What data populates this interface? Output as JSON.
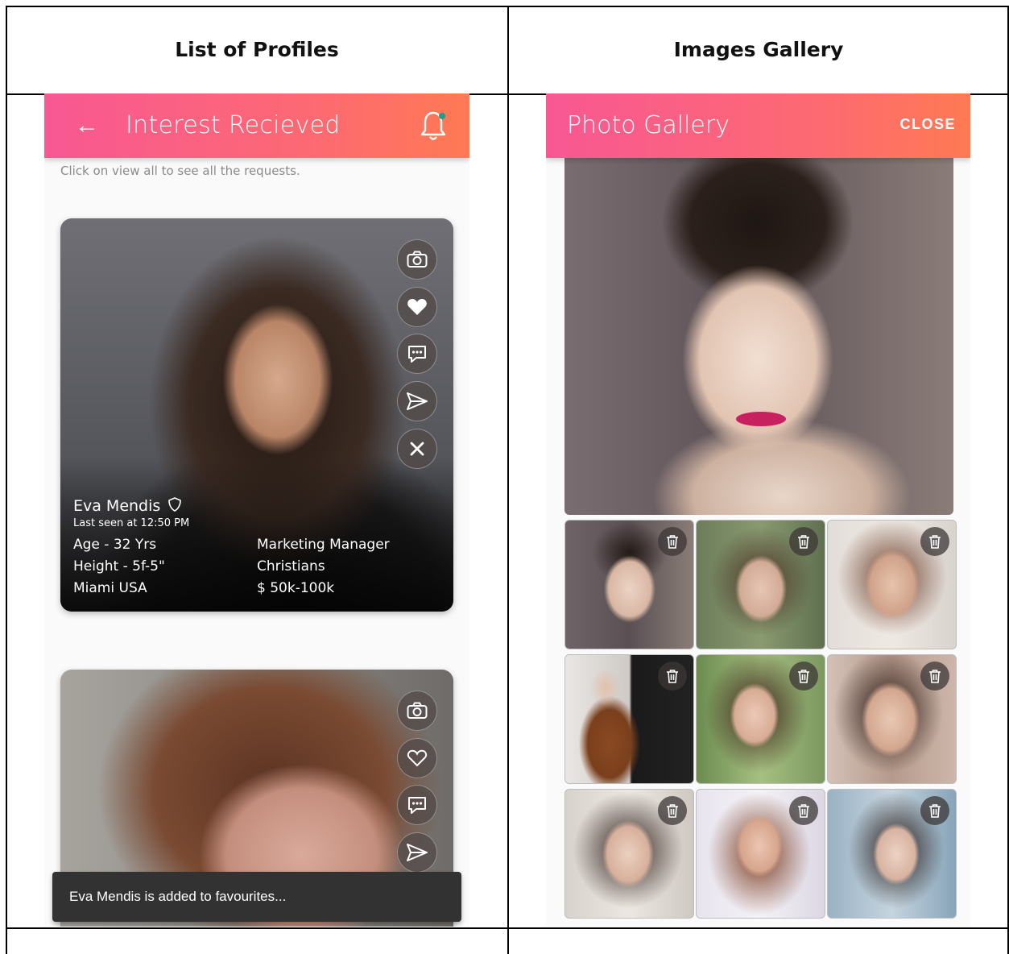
{
  "columns": [
    {
      "heading": "List of  Profiles"
    },
    {
      "heading": "Images Gallery"
    }
  ],
  "left_screen": {
    "appbar": {
      "back_icon": "arrow-left-icon",
      "title": "Interest Recieved",
      "notification_icon": "bell-icon",
      "notification_dot_color": "#1e9e86"
    },
    "hint": "Click on view all to see all the requests.",
    "profile": {
      "name": "Eva Mendis",
      "badge_icon": "shield-icon",
      "last_seen": "Last seen at 12:50 PM",
      "age": "Age - 32 Yrs",
      "height": "Height - 5f-5\"",
      "location": "Miami USA",
      "occupation": "Marketing Manager",
      "religion": "Christians",
      "income": "$ 50k-100k"
    },
    "actions": [
      "camera-icon",
      "heart-icon",
      "chat-icon",
      "send-icon",
      "close-icon"
    ],
    "snackbar": "Eva Mendis is added to favourites..."
  },
  "right_screen": {
    "appbar": {
      "title": "Photo Gallery",
      "close_label": "CLOSE"
    },
    "thumbnails": 9,
    "delete_icon": "trash-icon"
  },
  "colors": {
    "gradient_start": "#f85893",
    "gradient_end": "#fe7a53",
    "snackbar": "#323232"
  }
}
